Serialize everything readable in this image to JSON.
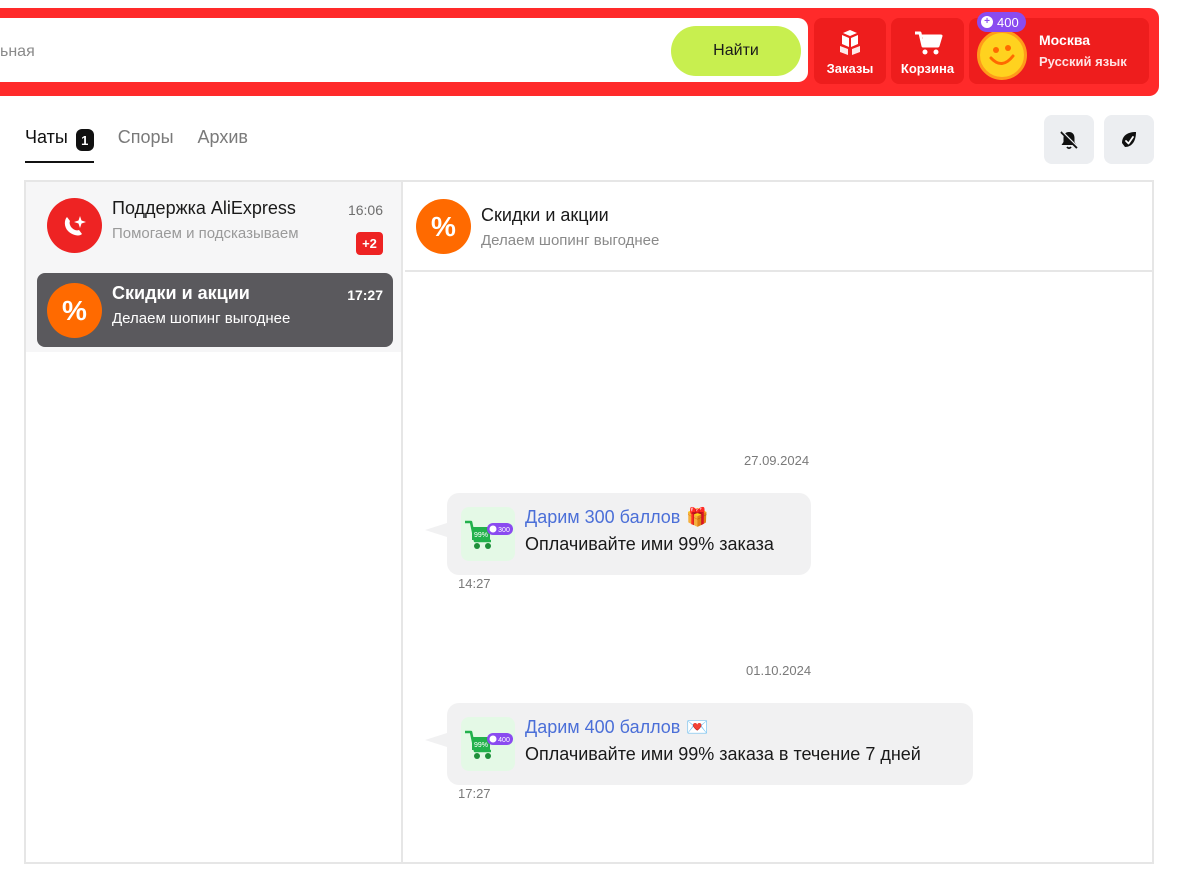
{
  "header": {
    "search_partial_text": "ьная",
    "find_label": "Найти",
    "orders_label": "Заказы",
    "cart_label": "Корзина",
    "points": "400",
    "city": "Москва",
    "language": "Русский язык",
    "brand_color": "#ff2a2a",
    "find_color": "#c8ef4f"
  },
  "tabs": [
    {
      "label": "Чаты",
      "badge": "1",
      "active": true
    },
    {
      "label": "Споры"
    },
    {
      "label": "Архив"
    }
  ],
  "toolbar_icons": [
    "bell-off-icon",
    "mark-read-icon"
  ],
  "chats": [
    {
      "name": "Поддержка AliExpress",
      "subtitle": "Помогаем и подсказываем",
      "time": "16:06",
      "unread": "+2",
      "icon": "support-icon",
      "color": "#ee2323"
    },
    {
      "name": "Скидки и акции",
      "subtitle": "Делаем шопинг выгоднее",
      "time": "17:27",
      "icon": "percent-icon",
      "color": "#ff6a00",
      "active": true
    }
  ],
  "conversation": {
    "title": "Скидки и акции",
    "subtitle": "Делаем шопинг выгоднее",
    "messages": [
      {
        "date": "27.09.2024",
        "title": "Дарим 300 баллов",
        "emoji": "🎁",
        "text": "Оплачивайте ими 99% заказа",
        "time": "14:27",
        "badge": "300",
        "badge_pct": "99%"
      },
      {
        "date": "01.10.2024",
        "title": "Дарим 400 баллов",
        "emoji": "💌",
        "text": "Оплачивайте ими 99% заказа в течение 7 дней",
        "time": "17:27",
        "badge": "400",
        "badge_pct": "99%"
      }
    ]
  }
}
